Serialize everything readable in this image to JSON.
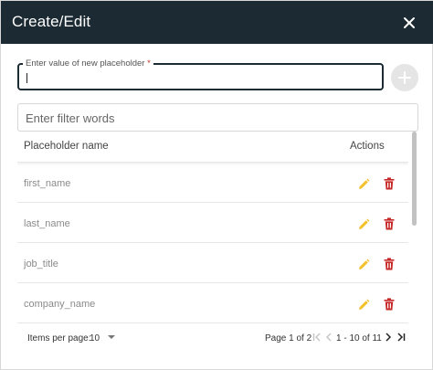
{
  "dialog": {
    "title": "Create/Edit"
  },
  "placeholder_field": {
    "label": "Enter value of new placeholder",
    "required_mark": "*",
    "value": ""
  },
  "filter": {
    "placeholder": "Enter filter words",
    "value": ""
  },
  "table": {
    "columns": [
      "Placeholder name",
      "Actions"
    ],
    "rows": [
      {
        "name": "first_name"
      },
      {
        "name": "last_name"
      },
      {
        "name": "job_title"
      },
      {
        "name": "company_name"
      }
    ]
  },
  "pagination": {
    "items_per_page_label": "Items per page:",
    "items_per_page_value": "10",
    "page_info": "Page 1 of 2",
    "range_info": "1 - 10 of 11"
  },
  "icons": {
    "close": "close-icon",
    "add": "plus-icon",
    "edit": "pencil-icon",
    "delete": "trash-icon",
    "first": "first-page-icon",
    "prev": "chevron-left-icon",
    "next": "chevron-right-icon",
    "last": "last-page-icon"
  },
  "colors": {
    "header_bg": "#1b2a33",
    "edit_icon": "#f2c12e",
    "delete_icon": "#c62828",
    "add_button_bg": "#e5e5e5"
  }
}
